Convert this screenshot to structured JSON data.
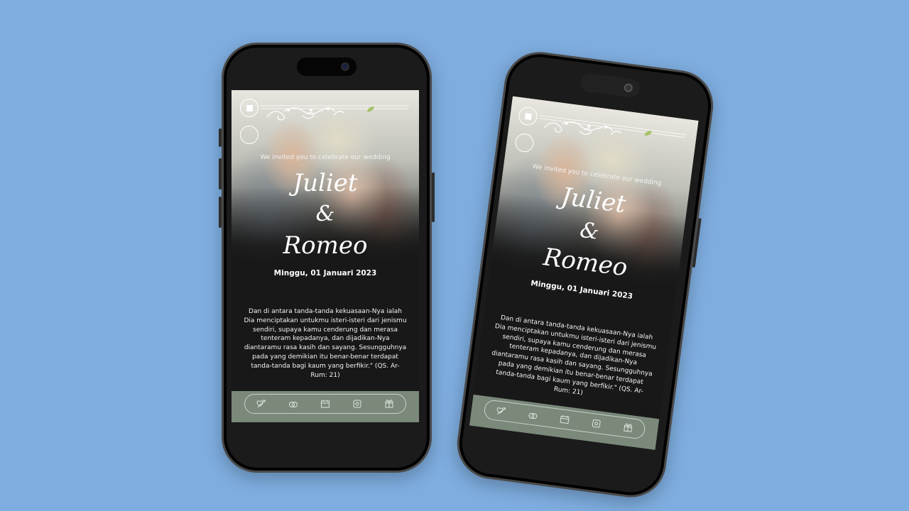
{
  "background_color": "#7eaddf",
  "invitation": {
    "invite_text": "We invited you to celebrate our wedding",
    "groom_name": "Juliet",
    "ampersand": "&",
    "bride_name": "Romeo",
    "date": "Minggu, 01 Januari 2023",
    "verse": "Dan di antara tanda-tanda kekuasaan-Nya ialah Dia menciptakan untukmu isteri-isteri dari jenismu sendiri, supaya kamu cenderung dan merasa tenteram kepadanya, dan dijadikan-Nya diantaramu rasa kasih dan sayang. Sesungguhnya pada yang demikian itu benar-benar terdapat tanda-tanda bagi kaum yang berfikir.\" (QS. Ar-Rum: 21)"
  },
  "controls": {
    "stop_icon": "stop-icon",
    "second_icon": "circle-button"
  },
  "bottom_nav": {
    "color": "#7a897a",
    "items": [
      {
        "icon": "heart-arrow-icon"
      },
      {
        "icon": "rings-icon"
      },
      {
        "icon": "calendar-icon"
      },
      {
        "icon": "gallery-icon"
      },
      {
        "icon": "gift-icon"
      }
    ]
  }
}
